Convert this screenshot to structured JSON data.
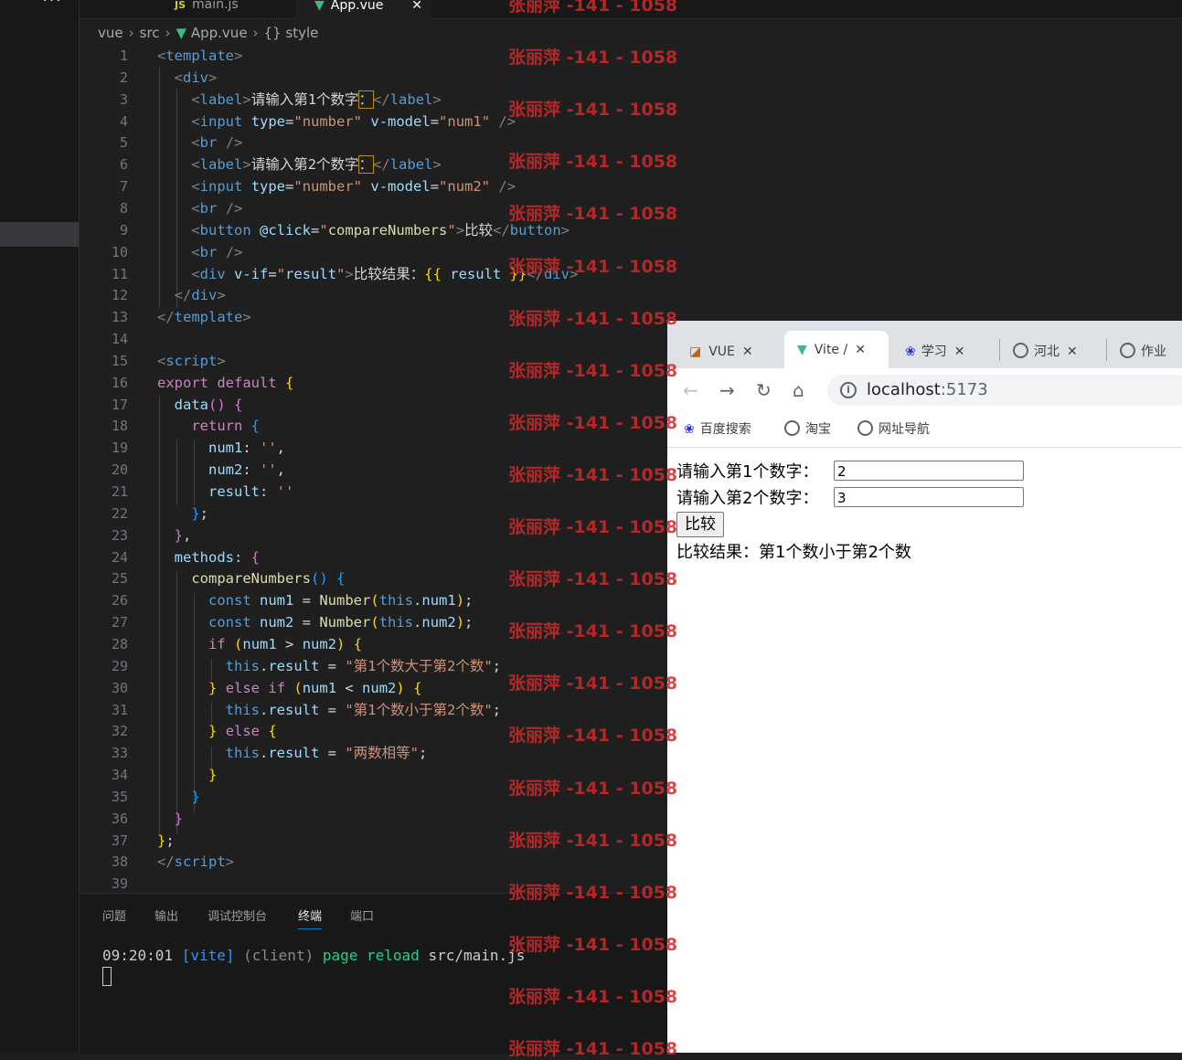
{
  "editor": {
    "tabs": [
      {
        "label": "main.js",
        "icon": "JS"
      },
      {
        "label": "App.vue",
        "icon": "vue-icon",
        "close": "✕"
      }
    ],
    "breadcrumb": [
      "vue",
      "src",
      "App.vue",
      "{} style"
    ],
    "line_numbers": [
      "1",
      "2",
      "3",
      "4",
      "5",
      "6",
      "7",
      "8",
      "9",
      "10",
      "11",
      "12",
      "13",
      "14",
      "15",
      "16",
      "17",
      "18",
      "19",
      "20",
      "21",
      "22",
      "23",
      "24",
      "25",
      "26",
      "27",
      "28",
      "29",
      "30",
      "31",
      "32",
      "33",
      "34",
      "35",
      "36",
      "37",
      "38",
      "39"
    ],
    "lines": [
      [
        [
          "tg",
          "<"
        ],
        [
          "tn",
          "template"
        ],
        [
          "tg",
          ">"
        ]
      ],
      [
        [
          "wt",
          "  "
        ],
        [
          "tg",
          "<"
        ],
        [
          "tn",
          "div"
        ],
        [
          "tg",
          ">"
        ]
      ],
      [
        [
          "wt",
          "    "
        ],
        [
          "tg",
          "<"
        ],
        [
          "tn",
          "label"
        ],
        [
          "tg",
          ">"
        ],
        [
          "tx",
          "请输入第1个数字"
        ],
        [
          "hl",
          "："
        ],
        [
          "tg",
          "</"
        ],
        [
          "tn",
          "label"
        ],
        [
          "tg",
          ">"
        ]
      ],
      [
        [
          "wt",
          "    "
        ],
        [
          "tg",
          "<"
        ],
        [
          "tn",
          "input"
        ],
        [
          "wt",
          " "
        ],
        [
          "at",
          "type"
        ],
        [
          "wt",
          "="
        ],
        [
          "st",
          "\"number\""
        ],
        [
          "wt",
          " "
        ],
        [
          "at",
          "v-model"
        ],
        [
          "wt",
          "="
        ],
        [
          "st",
          "\"num1\""
        ],
        [
          "wt",
          " "
        ],
        [
          "tg",
          "/>"
        ]
      ],
      [
        [
          "wt",
          "    "
        ],
        [
          "tg",
          "<"
        ],
        [
          "tn",
          "br"
        ],
        [
          "wt",
          " "
        ],
        [
          "tg",
          "/>"
        ]
      ],
      [
        [
          "wt",
          "    "
        ],
        [
          "tg",
          "<"
        ],
        [
          "tn",
          "label"
        ],
        [
          "tg",
          ">"
        ],
        [
          "tx",
          "请输入第2个数字"
        ],
        [
          "hl",
          "："
        ],
        [
          "tg",
          "</"
        ],
        [
          "tn",
          "label"
        ],
        [
          "tg",
          ">"
        ]
      ],
      [
        [
          "wt",
          "    "
        ],
        [
          "tg",
          "<"
        ],
        [
          "tn",
          "input"
        ],
        [
          "wt",
          " "
        ],
        [
          "at",
          "type"
        ],
        [
          "wt",
          "="
        ],
        [
          "st",
          "\"number\""
        ],
        [
          "wt",
          " "
        ],
        [
          "at",
          "v-model"
        ],
        [
          "wt",
          "="
        ],
        [
          "st",
          "\"num2\""
        ],
        [
          "wt",
          " "
        ],
        [
          "tg",
          "/>"
        ]
      ],
      [
        [
          "wt",
          "    "
        ],
        [
          "tg",
          "<"
        ],
        [
          "tn",
          "br"
        ],
        [
          "wt",
          " "
        ],
        [
          "tg",
          "/>"
        ]
      ],
      [
        [
          "wt",
          "    "
        ],
        [
          "tg",
          "<"
        ],
        [
          "tn",
          "button"
        ],
        [
          "wt",
          " "
        ],
        [
          "at",
          "@click"
        ],
        [
          "wt",
          "="
        ],
        [
          "st",
          "\""
        ],
        [
          "fn",
          "compareNumbers"
        ],
        [
          "st",
          "\""
        ],
        [
          "tg",
          ">"
        ],
        [
          "tx",
          "比较"
        ],
        [
          "tg",
          "</"
        ],
        [
          "tn",
          "button"
        ],
        [
          "tg",
          ">"
        ]
      ],
      [
        [
          "wt",
          "    "
        ],
        [
          "tg",
          "<"
        ],
        [
          "tn",
          "br"
        ],
        [
          "wt",
          " "
        ],
        [
          "tg",
          "/>"
        ]
      ],
      [
        [
          "wt",
          "    "
        ],
        [
          "tg",
          "<"
        ],
        [
          "tn",
          "div"
        ],
        [
          "wt",
          " "
        ],
        [
          "at",
          "v-if"
        ],
        [
          "wt",
          "="
        ],
        [
          "st",
          "\""
        ],
        [
          "vr",
          "result"
        ],
        [
          "st",
          "\""
        ],
        [
          "tg",
          ">"
        ],
        [
          "tx",
          "比较结果："
        ],
        [
          "b1",
          "{{"
        ],
        [
          "wt",
          " "
        ],
        [
          "vr",
          "result"
        ],
        [
          "wt",
          " "
        ],
        [
          "b1",
          "}}"
        ],
        [
          "tg",
          "</"
        ],
        [
          "tn",
          "div"
        ],
        [
          "tg",
          ">"
        ]
      ],
      [
        [
          "wt",
          "  "
        ],
        [
          "tg",
          "</"
        ],
        [
          "tn",
          "div"
        ],
        [
          "tg",
          ">"
        ]
      ],
      [
        [
          "tg",
          "</"
        ],
        [
          "tn",
          "template"
        ],
        [
          "tg",
          ">"
        ]
      ],
      [],
      [
        [
          "tg",
          "<"
        ],
        [
          "tn",
          "script"
        ],
        [
          "tg",
          ">"
        ]
      ],
      [
        [
          "kw",
          "export"
        ],
        [
          "wt",
          " "
        ],
        [
          "kw",
          "default"
        ],
        [
          "wt",
          " "
        ],
        [
          "b1",
          "{"
        ]
      ],
      [
        [
          "wt",
          "  "
        ],
        [
          "vr",
          "data"
        ],
        [
          "b2",
          "()"
        ],
        [
          "wt",
          " "
        ],
        [
          "b2",
          "{"
        ]
      ],
      [
        [
          "wt",
          "    "
        ],
        [
          "kw",
          "return"
        ],
        [
          "wt",
          " "
        ],
        [
          "b3",
          "{"
        ]
      ],
      [
        [
          "wt",
          "      "
        ],
        [
          "vr",
          "num1"
        ],
        [
          "wt",
          ": "
        ],
        [
          "st",
          "''"
        ],
        [
          "wt",
          ","
        ]
      ],
      [
        [
          "wt",
          "      "
        ],
        [
          "vr",
          "num2"
        ],
        [
          "wt",
          ": "
        ],
        [
          "st",
          "''"
        ],
        [
          "wt",
          ","
        ]
      ],
      [
        [
          "wt",
          "      "
        ],
        [
          "vr",
          "result"
        ],
        [
          "wt",
          ": "
        ],
        [
          "st",
          "''"
        ]
      ],
      [
        [
          "wt",
          "    "
        ],
        [
          "b3",
          "}"
        ],
        [
          "wt",
          ";"
        ]
      ],
      [
        [
          "wt",
          "  "
        ],
        [
          "b2",
          "}"
        ],
        [
          "wt",
          ","
        ]
      ],
      [
        [
          "wt",
          "  "
        ],
        [
          "vr",
          "methods"
        ],
        [
          "wt",
          ": "
        ],
        [
          "b2",
          "{"
        ]
      ],
      [
        [
          "wt",
          "    "
        ],
        [
          "fn",
          "compareNumbers"
        ],
        [
          "b3",
          "()"
        ],
        [
          "wt",
          " "
        ],
        [
          "b3",
          "{"
        ]
      ],
      [
        [
          "wt",
          "      "
        ],
        [
          "bl",
          "const"
        ],
        [
          "wt",
          " "
        ],
        [
          "vr",
          "num1"
        ],
        [
          "wt",
          " = "
        ],
        [
          "fn",
          "Number"
        ],
        [
          "b1",
          "("
        ],
        [
          "bl",
          "this"
        ],
        [
          "wt",
          "."
        ],
        [
          "vr",
          "num1"
        ],
        [
          "b1",
          ")"
        ],
        [
          "wt",
          ";"
        ]
      ],
      [
        [
          "wt",
          "      "
        ],
        [
          "bl",
          "const"
        ],
        [
          "wt",
          " "
        ],
        [
          "vr",
          "num2"
        ],
        [
          "wt",
          " = "
        ],
        [
          "fn",
          "Number"
        ],
        [
          "b1",
          "("
        ],
        [
          "bl",
          "this"
        ],
        [
          "wt",
          "."
        ],
        [
          "vr",
          "num2"
        ],
        [
          "b1",
          ")"
        ],
        [
          "wt",
          ";"
        ]
      ],
      [
        [
          "wt",
          "      "
        ],
        [
          "kw",
          "if"
        ],
        [
          "wt",
          " "
        ],
        [
          "b1",
          "("
        ],
        [
          "vr",
          "num1"
        ],
        [
          "wt",
          " > "
        ],
        [
          "vr",
          "num2"
        ],
        [
          "b1",
          ")"
        ],
        [
          "wt",
          " "
        ],
        [
          "b1",
          "{"
        ]
      ],
      [
        [
          "wt",
          "        "
        ],
        [
          "bl",
          "this"
        ],
        [
          "wt",
          "."
        ],
        [
          "vr",
          "result"
        ],
        [
          "wt",
          " = "
        ],
        [
          "st",
          "\"第1个数大于第2个数\""
        ],
        [
          "wt",
          ";"
        ]
      ],
      [
        [
          "wt",
          "      "
        ],
        [
          "b1",
          "}"
        ],
        [
          "wt",
          " "
        ],
        [
          "kw",
          "else"
        ],
        [
          "wt",
          " "
        ],
        [
          "kw",
          "if"
        ],
        [
          "wt",
          " "
        ],
        [
          "b1",
          "("
        ],
        [
          "vr",
          "num1"
        ],
        [
          "wt",
          " < "
        ],
        [
          "vr",
          "num2"
        ],
        [
          "b1",
          ")"
        ],
        [
          "wt",
          " "
        ],
        [
          "b1",
          "{"
        ]
      ],
      [
        [
          "wt",
          "        "
        ],
        [
          "bl",
          "this"
        ],
        [
          "wt",
          "."
        ],
        [
          "vr",
          "result"
        ],
        [
          "wt",
          " = "
        ],
        [
          "st",
          "\"第1个数小于第2个数\""
        ],
        [
          "wt",
          ";"
        ]
      ],
      [
        [
          "wt",
          "      "
        ],
        [
          "b1",
          "}"
        ],
        [
          "wt",
          " "
        ],
        [
          "kw",
          "else"
        ],
        [
          "wt",
          " "
        ],
        [
          "b1",
          "{"
        ]
      ],
      [
        [
          "wt",
          "        "
        ],
        [
          "bl",
          "this"
        ],
        [
          "wt",
          "."
        ],
        [
          "vr",
          "result"
        ],
        [
          "wt",
          " = "
        ],
        [
          "st",
          "\"两数相等\""
        ],
        [
          "wt",
          ";"
        ]
      ],
      [
        [
          "wt",
          "      "
        ],
        [
          "b1",
          "}"
        ]
      ],
      [
        [
          "wt",
          "    "
        ],
        [
          "b3",
          "}"
        ]
      ],
      [
        [
          "wt",
          "  "
        ],
        [
          "b2",
          "}"
        ]
      ],
      [
        [
          "b1",
          "}"
        ],
        [
          "wt",
          ";"
        ]
      ],
      [
        [
          "tg",
          "</"
        ],
        [
          "tn",
          "script"
        ],
        [
          "tg",
          ">"
        ]
      ],
      []
    ]
  },
  "panel": {
    "tabs": [
      "问题",
      "输出",
      "调试控制台",
      "终端",
      "端口"
    ],
    "active_tab": "终端",
    "terminal": {
      "time": "09:20:01",
      "tag": "[vite]",
      "client": "(client)",
      "action": "page reload",
      "file": "src/main.js"
    }
  },
  "watermark": "张丽萍 -141 - 1058",
  "browser": {
    "tabs": [
      {
        "label": "VUE",
        "icon": "vue-cat-icon"
      },
      {
        "label": "Vite /",
        "icon": "vue-icon"
      },
      {
        "label": "学习",
        "icon": "baidu-paw-icon"
      },
      {
        "label": "河北",
        "icon": "globe-icon"
      },
      {
        "label": "作业",
        "icon": "globe-icon"
      }
    ],
    "close_glyph": "✕",
    "url_host": "localhost",
    "url_port": ":5173",
    "bookmarks": [
      "百度搜索",
      "淘宝",
      "网址导航"
    ],
    "page": {
      "label1": "请输入第1个数字：",
      "value1": "2",
      "label2": "请输入第2个数字：",
      "value2": "3",
      "button": "比较",
      "result_prefix": "比较结果：",
      "result": "第1个数小于第2个数"
    }
  },
  "colors": {
    "editor_bg": "#1f1f1f",
    "accent": "#0078d4",
    "vue_green": "#41b883",
    "watermark_red": "#cc2a2a"
  }
}
